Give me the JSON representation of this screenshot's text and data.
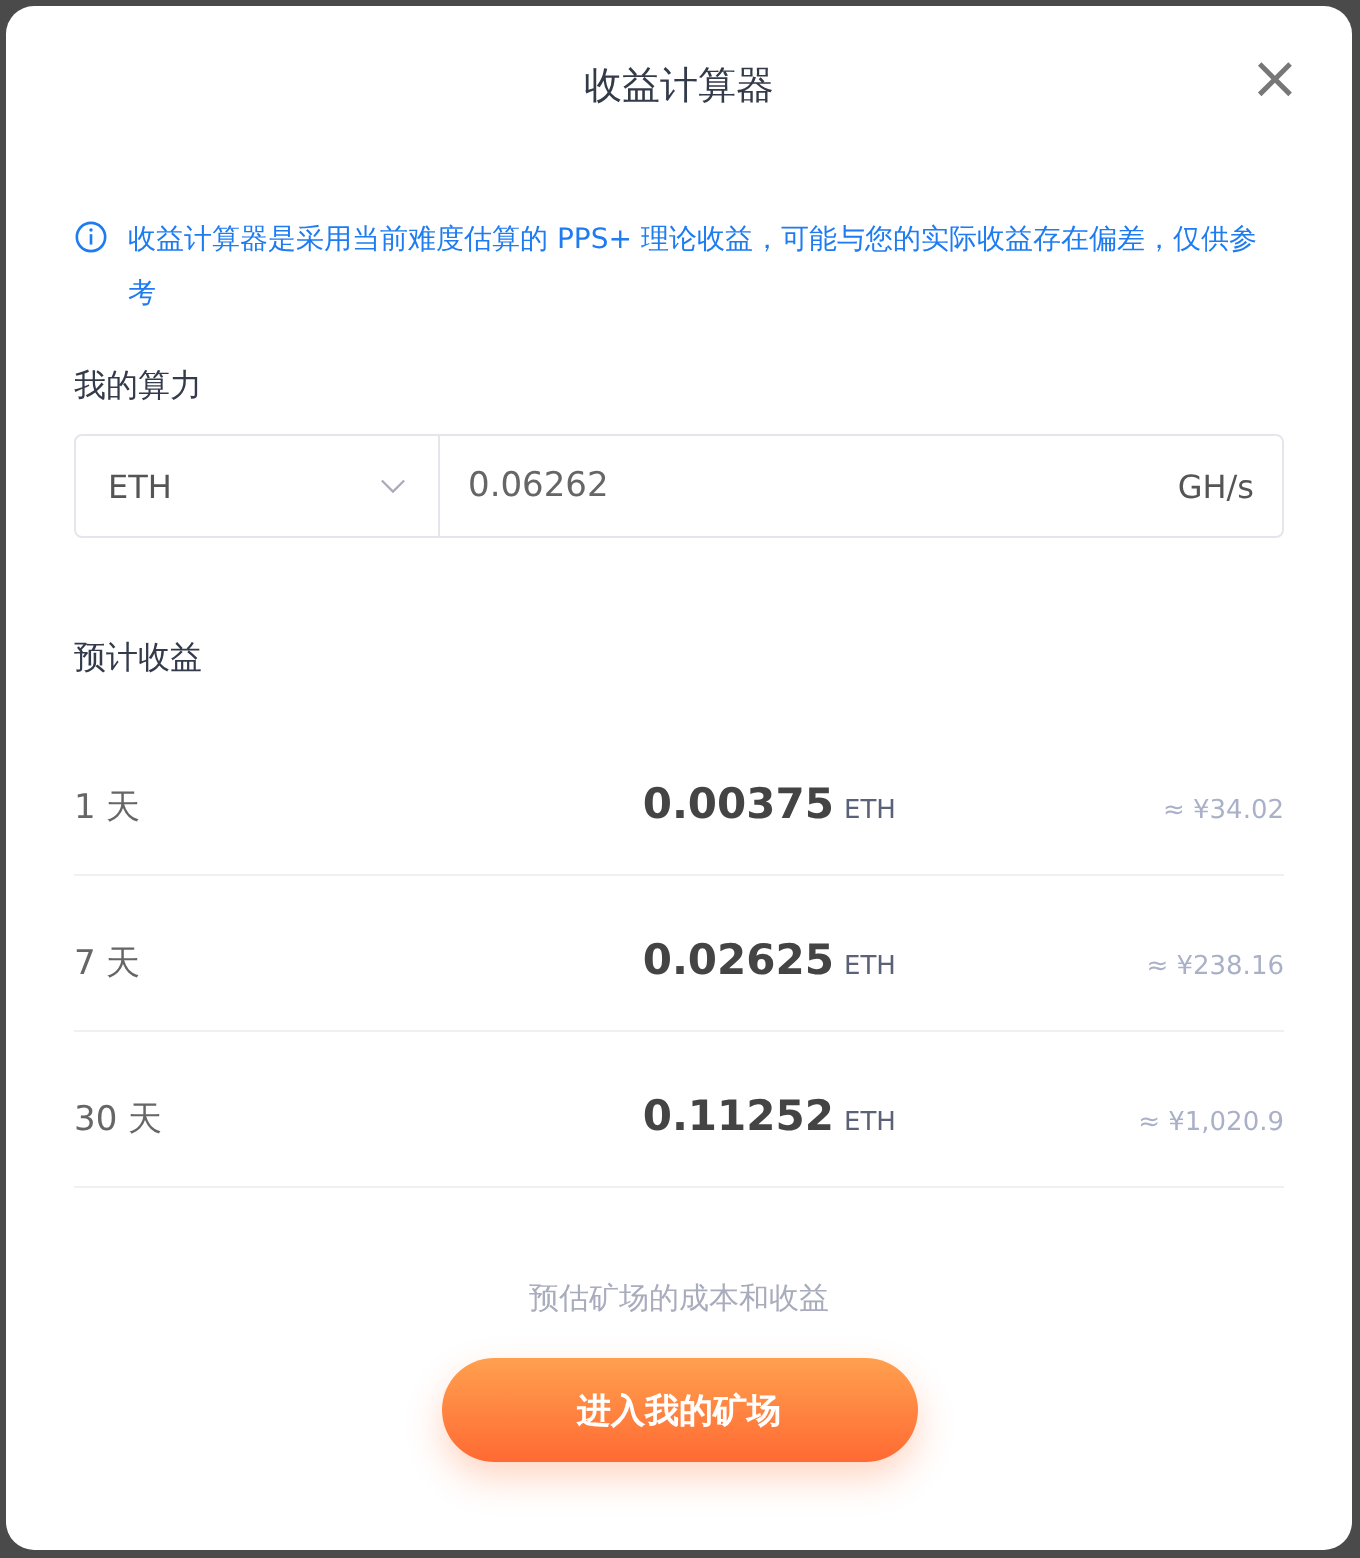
{
  "dialog": {
    "title": "收益计算器",
    "close": "×"
  },
  "notice": "收益计算器是采用当前难度估算的 PPS+ 理论收益，可能与您的实际收益存在偏差，仅供参考",
  "hashrate": {
    "label": "我的算力",
    "coin": "ETH",
    "value": "0.06262",
    "unit": "GH/s"
  },
  "estimate": {
    "label": "预计收益",
    "rows": [
      {
        "period": "1 天",
        "amount": "0.00375",
        "unit": "ETH",
        "fiat": "≈ ¥34.02"
      },
      {
        "period": "7 天",
        "amount": "0.02625",
        "unit": "ETH",
        "fiat": "≈ ¥238.16"
      },
      {
        "period": "30 天",
        "amount": "0.11252",
        "unit": "ETH",
        "fiat": "≈ ¥1,020.9"
      }
    ]
  },
  "footer": {
    "hint": "预估矿场的成本和收益",
    "button": "进入我的矿场"
  }
}
